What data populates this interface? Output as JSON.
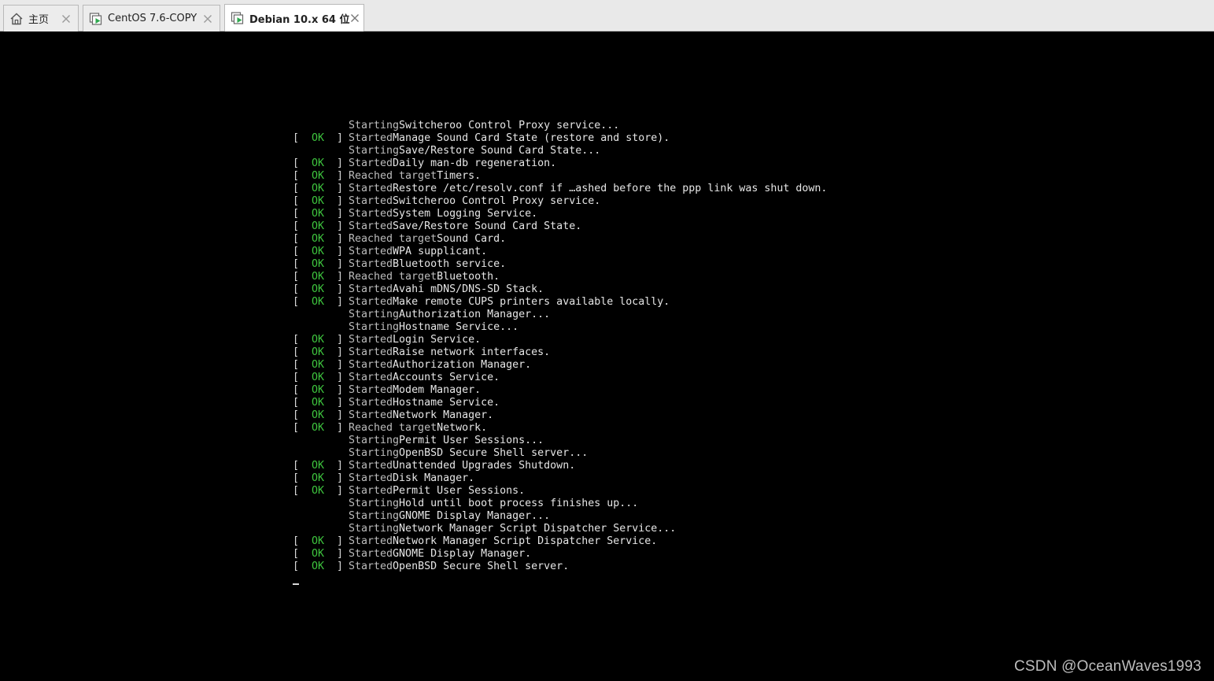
{
  "tabs": [
    {
      "label": "主页",
      "icon": "home-icon",
      "active": false
    },
    {
      "label": "CentOS 7.6-COPY",
      "icon": "vm-running-icon",
      "active": false
    },
    {
      "label": "Debian 10.x 64 位",
      "icon": "vm-running-icon",
      "active": true
    }
  ],
  "colors": {
    "ok_green": "#3ec43e",
    "console_bg": "#000000",
    "text": "#d8d8d8"
  },
  "console": {
    "lines": [
      {
        "status": "",
        "verb": "Starting",
        "subject": "Switcheroo Control Proxy service..."
      },
      {
        "status": "OK",
        "verb": "Started",
        "subject": "Manage Sound Card State (restore and store)."
      },
      {
        "status": "",
        "verb": "Starting",
        "subject": "Save/Restore Sound Card State..."
      },
      {
        "status": "OK",
        "verb": "Started",
        "subject": "Daily man-db regeneration."
      },
      {
        "status": "OK",
        "verb": "Reached target",
        "subject": "Timers."
      },
      {
        "status": "OK",
        "verb": "Started",
        "subject": "Restore /etc/resolv.conf if …ashed before the ppp link was shut down."
      },
      {
        "status": "OK",
        "verb": "Started",
        "subject": "Switcheroo Control Proxy service."
      },
      {
        "status": "OK",
        "verb": "Started",
        "subject": "System Logging Service."
      },
      {
        "status": "OK",
        "verb": "Started",
        "subject": "Save/Restore Sound Card State."
      },
      {
        "status": "OK",
        "verb": "Reached target",
        "subject": "Sound Card."
      },
      {
        "status": "OK",
        "verb": "Started",
        "subject": "WPA supplicant."
      },
      {
        "status": "OK",
        "verb": "Started",
        "subject": "Bluetooth service."
      },
      {
        "status": "OK",
        "verb": "Reached target",
        "subject": "Bluetooth."
      },
      {
        "status": "OK",
        "verb": "Started",
        "subject": "Avahi mDNS/DNS-SD Stack."
      },
      {
        "status": "OK",
        "verb": "Started",
        "subject": "Make remote CUPS printers available locally."
      },
      {
        "status": "",
        "verb": "Starting",
        "subject": "Authorization Manager..."
      },
      {
        "status": "",
        "verb": "Starting",
        "subject": "Hostname Service..."
      },
      {
        "status": "OK",
        "verb": "Started",
        "subject": "Login Service."
      },
      {
        "status": "OK",
        "verb": "Started",
        "subject": "Raise network interfaces."
      },
      {
        "status": "OK",
        "verb": "Started",
        "subject": "Authorization Manager."
      },
      {
        "status": "OK",
        "verb": "Started",
        "subject": "Accounts Service."
      },
      {
        "status": "OK",
        "verb": "Started",
        "subject": "Modem Manager."
      },
      {
        "status": "OK",
        "verb": "Started",
        "subject": "Hostname Service."
      },
      {
        "status": "OK",
        "verb": "Started",
        "subject": "Network Manager."
      },
      {
        "status": "OK",
        "verb": "Reached target",
        "subject": "Network."
      },
      {
        "status": "",
        "verb": "Starting",
        "subject": "Permit User Sessions..."
      },
      {
        "status": "",
        "verb": "Starting",
        "subject": "OpenBSD Secure Shell server..."
      },
      {
        "status": "OK",
        "verb": "Started",
        "subject": "Unattended Upgrades Shutdown."
      },
      {
        "status": "OK",
        "verb": "Started",
        "subject": "Disk Manager."
      },
      {
        "status": "OK",
        "verb": "Started",
        "subject": "Permit User Sessions."
      },
      {
        "status": "",
        "verb": "Starting",
        "subject": "Hold until boot process finishes up..."
      },
      {
        "status": "",
        "verb": "Starting",
        "subject": "GNOME Display Manager..."
      },
      {
        "status": "",
        "verb": "Starting",
        "subject": "Network Manager Script Dispatcher Service..."
      },
      {
        "status": "OK",
        "verb": "Started",
        "subject": "Network Manager Script Dispatcher Service."
      },
      {
        "status": "OK",
        "verb": "Started",
        "subject": "GNOME Display Manager."
      },
      {
        "status": "OK",
        "verb": "Started",
        "subject": "OpenBSD Secure Shell server."
      }
    ]
  },
  "watermark": "CSDN @OceanWaves1993"
}
